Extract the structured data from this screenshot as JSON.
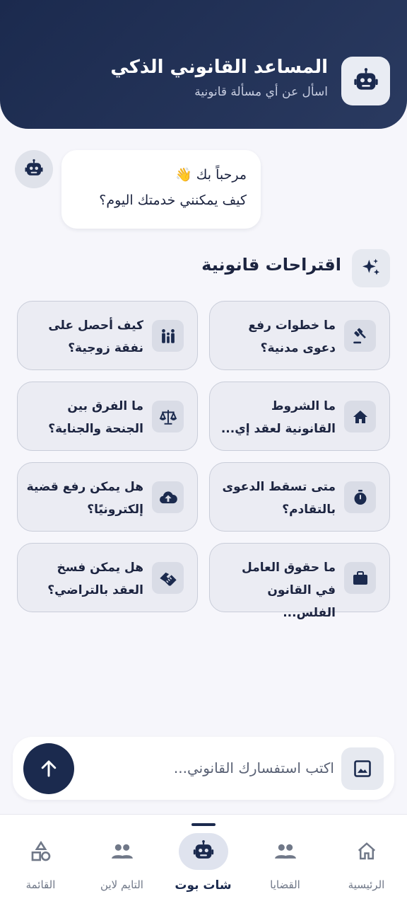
{
  "header": {
    "title": "المساعد القانوني الذكي",
    "subtitle": "اسأل عن أي مسألة قانونية",
    "icon": "robot-icon"
  },
  "chat": {
    "welcome_line1": "مرحباً بك 👋",
    "welcome_line2": "كيف يمكنني خدمتك اليوم؟"
  },
  "suggestions": {
    "title": "اقتراحات قانونية",
    "icon": "sparkles-icon",
    "items": [
      {
        "line1": "ما خطوات رفع",
        "line2": "دعوى مدنية؟",
        "icon": "gavel-icon"
      },
      {
        "line1": "كيف أحصل على",
        "line2": "نفقة زوجية؟",
        "icon": "family-icon"
      },
      {
        "line1": "ما الشروط",
        "line2": "القانونية لعقد إي...",
        "icon": "house-icon"
      },
      {
        "line1": "ما الفرق بين",
        "line2": "الجنحة والجناية؟",
        "icon": "scales-icon"
      },
      {
        "line1": "متى تسقط الدعوى",
        "line2": "بالتقادم؟",
        "icon": "stopwatch-icon"
      },
      {
        "line1": "هل يمكن رفع قضية",
        "line2": "إلكترونيًا؟",
        "icon": "cloud-upload-icon"
      },
      {
        "line1": "ما حقوق العامل",
        "line2": "في القانون الفلس...",
        "icon": "briefcase-icon"
      },
      {
        "line1": "هل يمكن فسخ",
        "line2": "العقد بالتراضي؟",
        "icon": "handshake-icon"
      }
    ]
  },
  "input": {
    "placeholder": "اكتب استفسارك القانوني...",
    "value": ""
  },
  "nav": {
    "items": [
      {
        "label": "الرئيسية",
        "icon": "home-icon"
      },
      {
        "label": "القضايا",
        "icon": "people-icon"
      },
      {
        "label": "شات بوت",
        "icon": "robot-icon",
        "active": true
      },
      {
        "label": "التايم لاين",
        "icon": "people-icon"
      },
      {
        "label": "القائمة",
        "icon": "shapes-icon"
      }
    ]
  },
  "colors": {
    "primary": "#1b2a4e",
    "background": "#f6f6fb",
    "card": "#ebecf3"
  }
}
